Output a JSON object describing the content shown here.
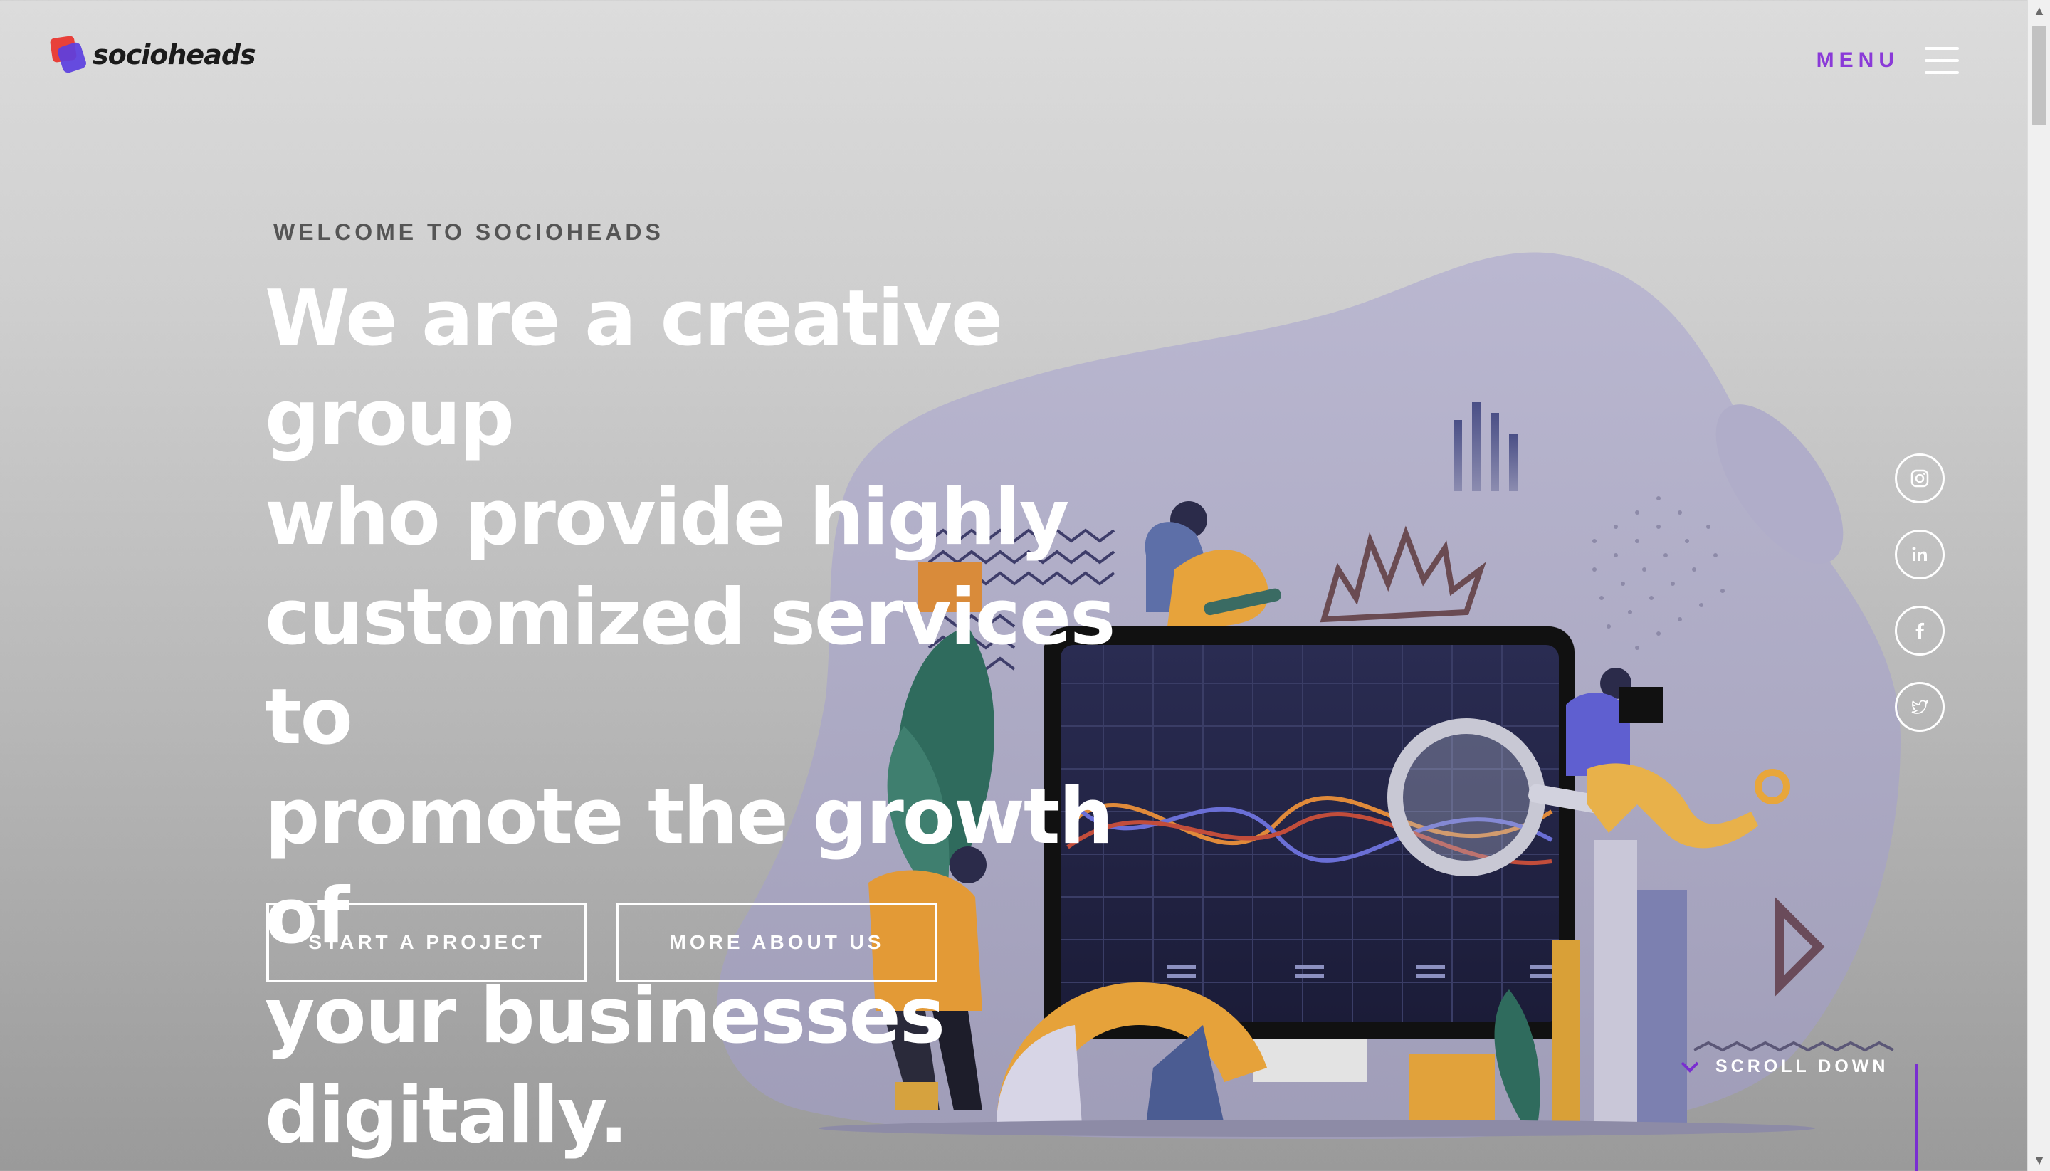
{
  "header": {
    "brand": "socioheads",
    "menu_label": "MENU"
  },
  "hero": {
    "eyebrow": "WELCOME TO SOCIOHEADS",
    "headline_lines": [
      "We are a creative group",
      "who provide highly",
      "customized services to",
      "promote the growth of",
      "your businesses digitally."
    ],
    "buttons": {
      "start": "START A PROJECT",
      "more": "MORE ABOUT US"
    }
  },
  "social": [
    {
      "name": "instagram-icon"
    },
    {
      "name": "linkedin-icon"
    },
    {
      "name": "facebook-icon"
    },
    {
      "name": "twitter-icon"
    }
  ],
  "scroll_down": "SCROLL DOWN",
  "colors": {
    "accent": "#8a3ad8",
    "text_light": "#ffffff",
    "blob": "#a9a6c7",
    "monitor": "#1d1f3e"
  }
}
